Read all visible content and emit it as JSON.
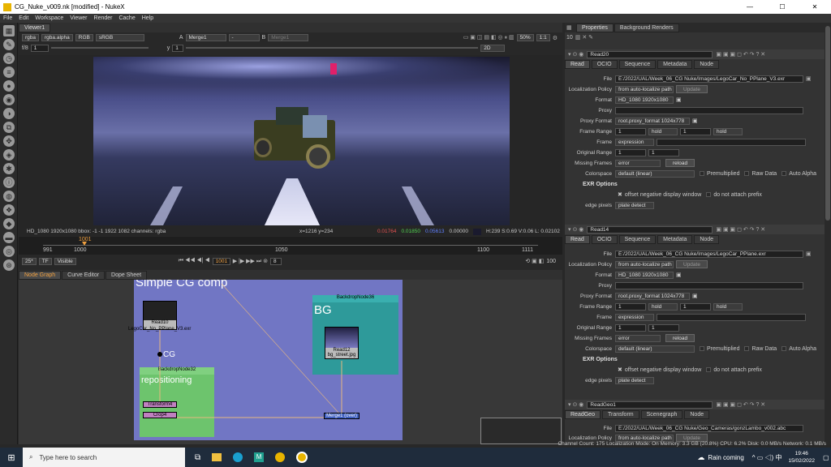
{
  "window": {
    "title": "CG_Nuke_v009.nk [modified] - NukeX",
    "minimize": "—",
    "maximize": "☐",
    "close": "✕"
  },
  "menu": [
    "File",
    "Edit",
    "Workspace",
    "Viewer",
    "Render",
    "Cache",
    "Help"
  ],
  "viewer": {
    "tab": "Viewer1",
    "channels": "rgba",
    "alpha": "rgba.alpha",
    "rgb": "RGB",
    "lut": "sRGB",
    "inputA": "Merge1",
    "inputA_prefix": "A",
    "dash": "-",
    "inputB_prefix": "B",
    "inputB": "Merge1",
    "zoom": "50%",
    "ratio": "1:1",
    "fstop": "f/8",
    "frame_field": "1",
    "y_label": "y",
    "y_value": "1",
    "view_mode": "2D",
    "info": "HD_1080 1920x1080  bbox: -1 -1 1922 1082 channels: rgba",
    "coords": "x=1216 y=234",
    "r": "0.01764",
    "g": "0.01850",
    "b": "0.05613",
    "a": "0.00000",
    "hsv": "H:239 S:0.69 V:0.06  L: 0.02102",
    "tl_start": "991",
    "tl_1000": "1000",
    "tl_1001": "1001",
    "tl_1050": "1050",
    "tl_1100": "1100",
    "tl_1111": "1111",
    "fps": "25*",
    "tf": "TF",
    "visible": "Visible",
    "current_frame": "1001",
    "step": "8",
    "end_frame": "100"
  },
  "bottom_tabs": [
    "Node Graph",
    "Curve Editor",
    "Dope Sheet"
  ],
  "graph": {
    "bg_title": "Simple CG comp",
    "backdrop36_label": "BackdropNode36",
    "backdrop36_text": "BG",
    "backdrop32_label": "BackdropNode32",
    "backdrop32_text": "repositioning",
    "read10": "Read10",
    "read10_file": "LegoCar_No_PPlane_V3.exr",
    "dot_label": "CG",
    "read12": "Read12",
    "read12_file": "bg_street.jpg",
    "transform": "Transform4",
    "crop": "Crop4",
    "merge": "Merge1 (over)"
  },
  "props": {
    "tabs": [
      "Properties",
      "Background Renders"
    ],
    "count": "10",
    "read20": {
      "name": "Read20",
      "tabs": [
        "Read",
        "OCIO",
        "Sequence",
        "Metadata",
        "Node"
      ],
      "file": "E:/2022/UAL/Week_06_CG Nuke/Images/LegoCar_No_PPlane_V3.exr",
      "localization": "from auto-localize path",
      "update": "Update",
      "format": "HD_1080 1920x1080",
      "proxy": "",
      "proxy_format": "root.proxy_format 1024x778",
      "range_a": "1",
      "hold_a": "hold",
      "range_b": "1",
      "hold_b": "hold",
      "frame": "expression",
      "orig_a": "1",
      "orig_b": "1",
      "missing": "error",
      "reload": "reload",
      "colorspace": "default (linear)",
      "premult": "Premultiplied",
      "raw": "Raw Data",
      "autoalpha": "Auto Alpha",
      "exr": "EXR Options",
      "offset": "offset negative display window",
      "noprefix": "do not attach prefix",
      "edge": "plate detect"
    },
    "read14": {
      "name": "Read14",
      "tabs": [
        "Read",
        "OCIO",
        "Sequence",
        "Metadata",
        "Node"
      ],
      "file": "E:/2022/UAL/Week_06_CG Nuke/Images/LegoCar_PPlane.exr",
      "localization": "from auto-localize path",
      "update": "Update",
      "format": "HD_1080 1920x1080",
      "proxy": "",
      "proxy_format": "root.proxy_format 1024x778",
      "range_a": "1",
      "hold_a": "hold",
      "range_b": "1",
      "hold_b": "hold",
      "frame": "expression",
      "orig_a": "1",
      "orig_b": "1",
      "missing": "error",
      "reload": "reload",
      "colorspace": "default (linear)",
      "premult": "Premultiplied",
      "raw": "Raw Data",
      "autoalpha": "Auto Alpha",
      "exr": "EXR Options",
      "offset": "offset negative display window",
      "noprefix": "do not attach prefix",
      "edge": "plate detect"
    },
    "readgeo": {
      "name": "ReadGeo1",
      "tabs": [
        "ReadGeo",
        "Transform",
        "Scenegraph",
        "Node"
      ],
      "file": "E:/2022/UAL/Week_06_CG Nuke/Geo_Cameras/gonzLambo_v002.abc",
      "localization": "from auto-localize path",
      "update": "Update"
    },
    "labels": {
      "file": "File",
      "localization": "Localization Policy",
      "format": "Format",
      "proxy": "Proxy",
      "proxy_format": "Proxy Format",
      "frame_range": "Frame Range",
      "frame": "Frame",
      "orig_range": "Original Range",
      "missing": "Missing Frames",
      "colorspace": "Colorspace",
      "edge": "edge pixels"
    }
  },
  "status": "Channel Count: 175  Localization Mode: On  Memory: 3.3 GB (20.8%)  CPU: 6.2%  Disk: 0.0 MB/s  Network: 0.1 MB/s",
  "taskbar": {
    "search": "Type here to search",
    "weather": "Rain coming",
    "time": "19:46",
    "date": "15/02/2022"
  }
}
